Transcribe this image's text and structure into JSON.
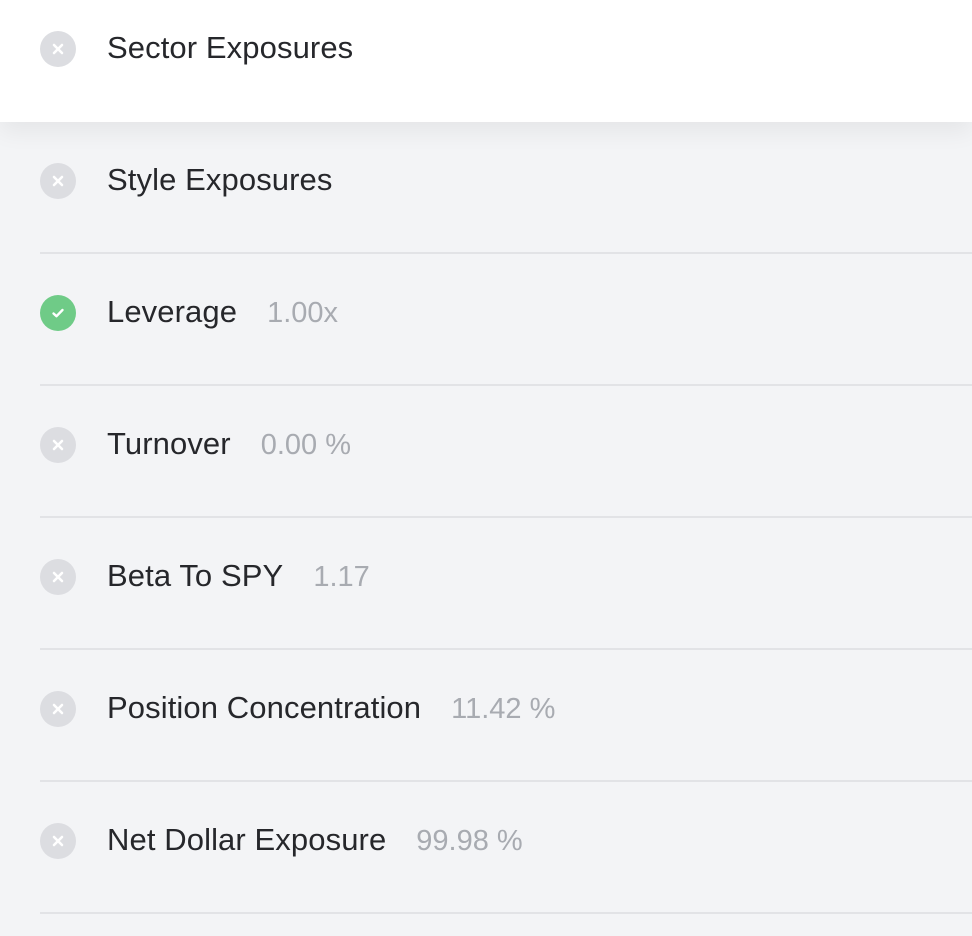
{
  "checks": [
    {
      "label": "Sector Exposures",
      "value": "",
      "status": "fail",
      "icon": "close-icon"
    },
    {
      "label": "Style Exposures",
      "value": "",
      "status": "fail",
      "icon": "close-icon"
    },
    {
      "label": "Leverage",
      "value": "1.00x",
      "status": "pass",
      "icon": "check-icon"
    },
    {
      "label": "Turnover",
      "value": "0.00 %",
      "status": "fail",
      "icon": "close-icon"
    },
    {
      "label": "Beta To SPY",
      "value": "1.17",
      "status": "fail",
      "icon": "close-icon"
    },
    {
      "label": "Position Concentration",
      "value": "11.42 %",
      "status": "fail",
      "icon": "close-icon"
    },
    {
      "label": "Net Dollar Exposure",
      "value": "99.98 %",
      "status": "fail",
      "icon": "close-icon"
    }
  ],
  "colors": {
    "pass": "#6fcb87",
    "fail": "#dcdde1",
    "label": "#26272b",
    "value": "#a8abb1",
    "divider": "#e2e3e6",
    "background": "#f3f4f6"
  }
}
